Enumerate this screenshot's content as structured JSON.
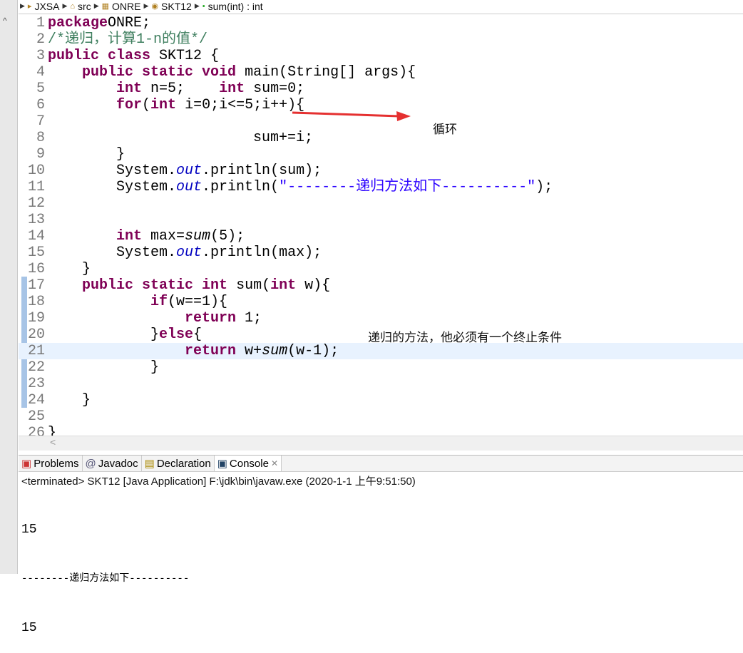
{
  "breadcrumb": [
    "JXSA",
    "src",
    "ONRE",
    "SKT12",
    "sum(int) : int"
  ],
  "code": [
    [
      [
        "kw",
        "package"
      ],
      [
        "",
        "ONRE;"
      ]
    ],
    [
      [
        "cmt",
        "/*递归，计算1-n的值*/"
      ]
    ],
    [
      [
        "kw",
        "public class"
      ],
      [
        "",
        " SKT12 {"
      ]
    ],
    [
      [
        "",
        "    "
      ],
      [
        "kw",
        "public static void"
      ],
      [
        "",
        " main(String[] args){"
      ]
    ],
    [
      [
        "",
        "        "
      ],
      [
        "kw",
        "int"
      ],
      [
        "",
        " n=5;    "
      ],
      [
        "kw",
        "int"
      ],
      [
        "",
        " sum=0;"
      ]
    ],
    [
      [
        "",
        "        "
      ],
      [
        "kw",
        "for"
      ],
      [
        "",
        "("
      ],
      [
        "kw",
        "int"
      ],
      [
        "",
        " i=0;i<=5;i++){"
      ]
    ],
    [],
    [
      [
        "",
        "                        sum+=i;"
      ]
    ],
    [
      [
        "",
        "        }"
      ]
    ],
    [
      [
        "",
        "        System."
      ],
      [
        "fld",
        "out"
      ],
      [
        "",
        ".println(sum);"
      ]
    ],
    [
      [
        "",
        "        System."
      ],
      [
        "fld",
        "out"
      ],
      [
        "",
        ".println("
      ],
      [
        "str",
        "\"--------递归方法如下----------\""
      ],
      [
        "",
        ");"
      ]
    ],
    [],
    [],
    [
      [
        "",
        "        "
      ],
      [
        "kw",
        "int"
      ],
      [
        "",
        " max="
      ],
      [
        "it",
        "sum"
      ],
      [
        "",
        "(5);"
      ]
    ],
    [
      [
        "",
        "        System."
      ],
      [
        "fld",
        "out"
      ],
      [
        "",
        ".println(max);"
      ]
    ],
    [
      [
        "",
        "    }"
      ]
    ],
    [
      [
        "",
        "    "
      ],
      [
        "kw",
        "public static int"
      ],
      [
        "",
        " sum("
      ],
      [
        "kw",
        "int"
      ],
      [
        "",
        " w){"
      ]
    ],
    [
      [
        "",
        "            "
      ],
      [
        "kw",
        "if"
      ],
      [
        "",
        "(w==1){"
      ]
    ],
    [
      [
        "",
        "                "
      ],
      [
        "kw",
        "return"
      ],
      [
        "",
        " 1;"
      ]
    ],
    [
      [
        "",
        "            }"
      ],
      [
        "kw",
        "else"
      ],
      [
        "",
        "{"
      ]
    ],
    [
      [
        "",
        "                "
      ],
      [
        "kw",
        "return"
      ],
      [
        "",
        " w+"
      ],
      [
        "it",
        "sum"
      ],
      [
        "",
        "(w-1);"
      ]
    ],
    [
      [
        "",
        "            }"
      ]
    ],
    [],
    [
      [
        "",
        "    }"
      ]
    ],
    [],
    [
      [
        "",
        "}"
      ]
    ]
  ],
  "annotations": {
    "loop": "循环",
    "recursion": "递归的方法，他必须有一个终止条件"
  },
  "tabs": [
    "Problems",
    "Javadoc",
    "Declaration",
    "Console"
  ],
  "console": {
    "status": "<terminated> SKT12 [Java Application] F:\\jdk\\bin\\javaw.exe (2020-1-1 上午9:51:50)",
    "output": [
      "15",
      "--------递归方法如下----------",
      "15"
    ]
  }
}
